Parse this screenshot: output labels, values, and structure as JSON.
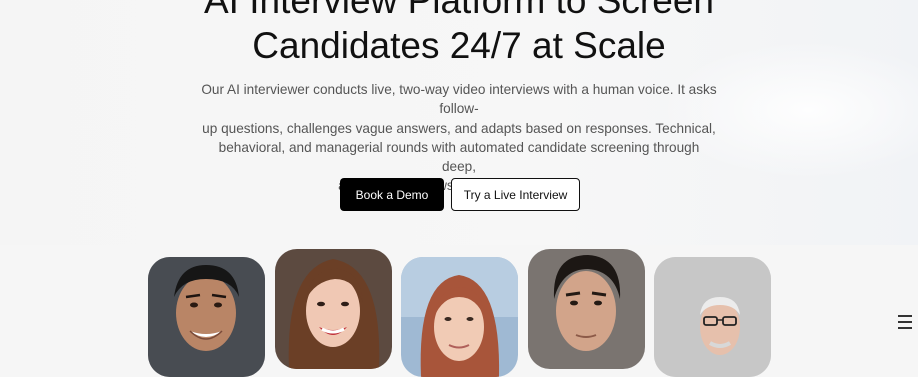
{
  "hero": {
    "title_line1": "AI Interview Platform to Screen",
    "title_line2": "Candidates 24/7 at Scale",
    "description_lines": [
      "Our AI interviewer conducts live, two-way video interviews with a human voice. It asks follow-",
      "up questions, challenges vague answers, and adapts based on responses. Technical,",
      "behavioral, and managerial rounds with automated candidate screening through deep,",
      "adaptive interviews. 24/7, any timezone."
    ]
  },
  "buttons": {
    "book_demo": "Book a Demo",
    "try_live": "Try a Live Interview"
  },
  "candidates": [
    {
      "icon": "candidate-portrait"
    },
    {
      "icon": "candidate-portrait"
    },
    {
      "icon": "candidate-portrait"
    },
    {
      "icon": "candidate-portrait"
    },
    {
      "icon": "candidate-portrait"
    }
  ],
  "colors": {
    "primary_button": "#000000",
    "secondary_button_border": "#111111",
    "background": "#f6f6f6"
  }
}
